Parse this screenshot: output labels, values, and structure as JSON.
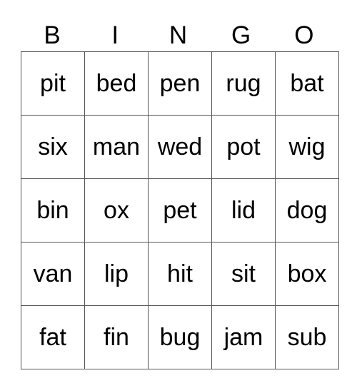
{
  "header": [
    "B",
    "I",
    "N",
    "G",
    "O"
  ],
  "rows": [
    [
      "pit",
      "bed",
      "pen",
      "rug",
      "bat"
    ],
    [
      "six",
      "man",
      "wed",
      "pot",
      "wig"
    ],
    [
      "bin",
      "ox",
      "pet",
      "lid",
      "dog"
    ],
    [
      "van",
      "lip",
      "hit",
      "sit",
      "box"
    ],
    [
      "fat",
      "fin",
      "bug",
      "jam",
      "sub"
    ]
  ]
}
